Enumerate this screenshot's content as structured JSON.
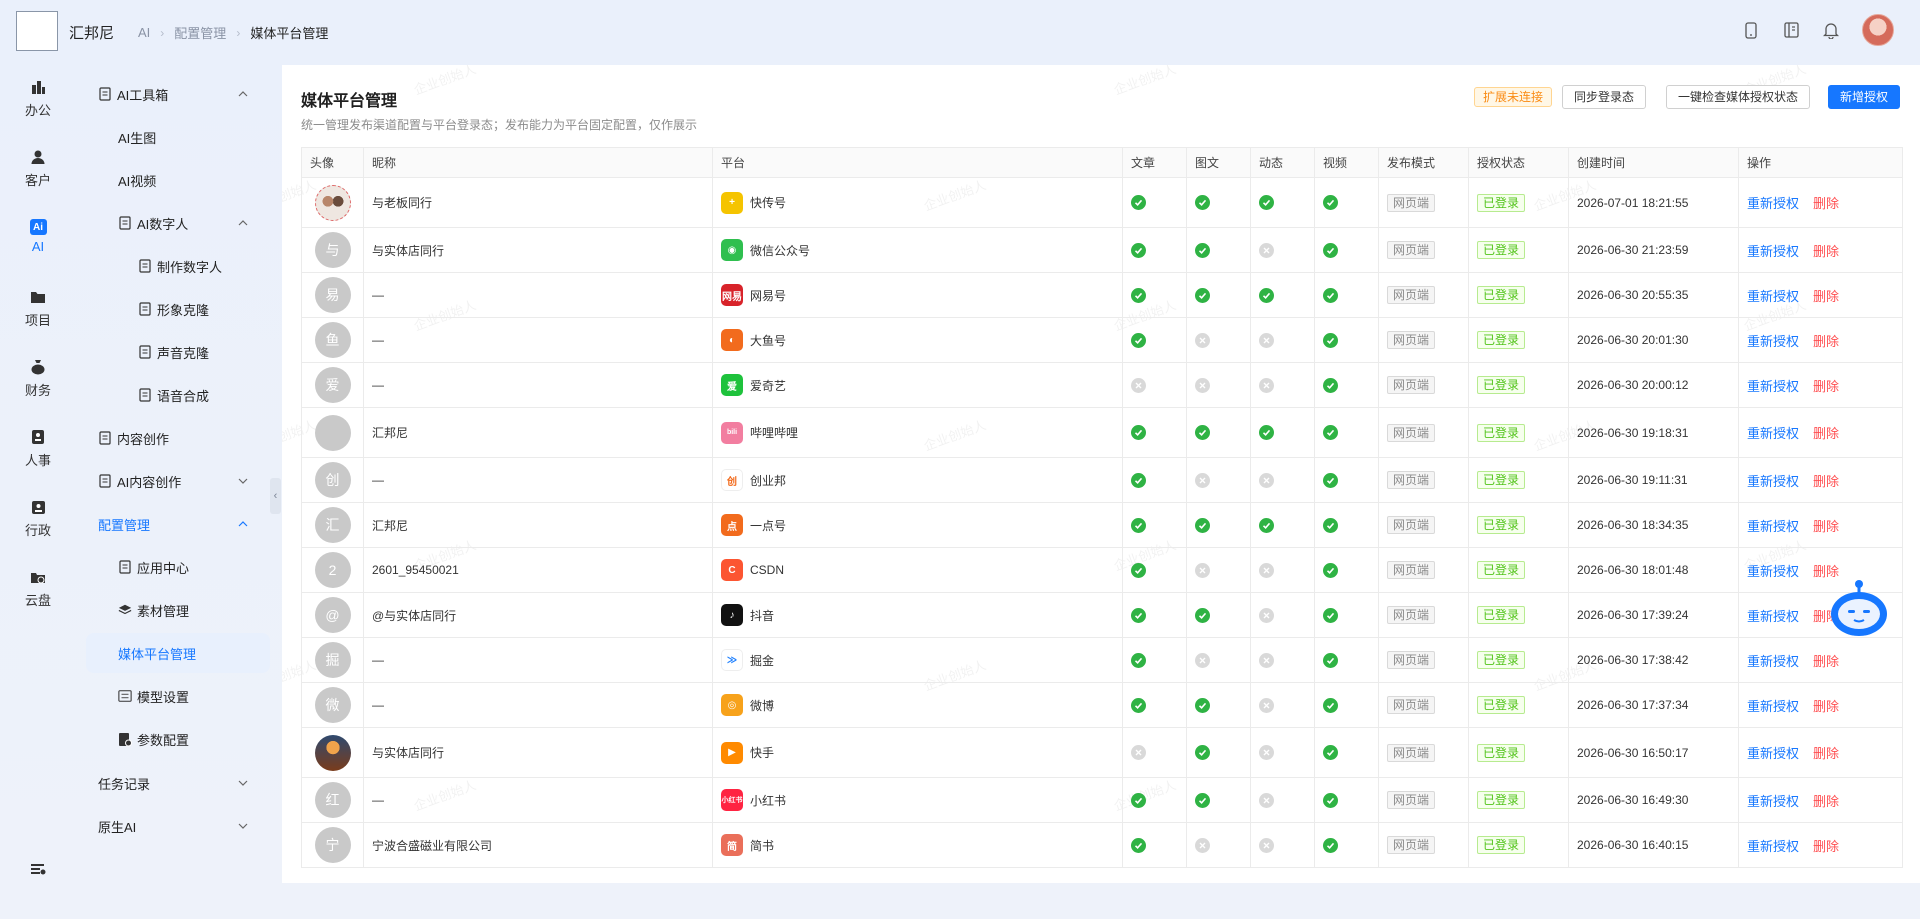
{
  "header": {
    "brand": "汇邦尼",
    "breadcrumbs": [
      "AI",
      "配置管理",
      "媒体平台管理"
    ]
  },
  "rail": [
    {
      "label": "办公",
      "icon": "office-icon"
    },
    {
      "label": "客户",
      "icon": "customer-icon"
    },
    {
      "label": "AI",
      "icon": "ai-icon",
      "active": true
    },
    {
      "label": "项目",
      "icon": "project-icon"
    },
    {
      "label": "财务",
      "icon": "finance-icon"
    },
    {
      "label": "人事",
      "icon": "hr-icon"
    },
    {
      "label": "行政",
      "icon": "admin-icon"
    },
    {
      "label": "云盘",
      "icon": "cloud-disk-icon"
    }
  ],
  "sidebar": {
    "ai_toolbox": "AI工具箱",
    "ai_image": "AI生图",
    "ai_video": "AI视频",
    "ai_digital_human": "AI数字人",
    "make_digital_human": "制作数字人",
    "image_clone": "形象克隆",
    "voice_clone": "声音克隆",
    "speech_synthesis": "语音合成",
    "content_creation": "内容创作",
    "ai_content_creation": "AI内容创作",
    "config_management": "配置管理",
    "app_center": "应用中心",
    "material_management": "素材管理",
    "media_platform": "媒体平台管理",
    "model_settings": "模型设置",
    "param_config": "参数配置",
    "task_records": "任务记录",
    "native_ai": "原生AI"
  },
  "main": {
    "title": "媒体平台管理",
    "subtitle": "统一管理发布渠道配置与平台登录态；发布能力为平台固定配置，仅作展示",
    "tag_extension": "扩展未连接",
    "btn_sync": "同步登录态",
    "btn_check": "一键检查媒体授权状态",
    "btn_add": "新增授权",
    "watermark": "企业创始人",
    "columns": [
      "头像",
      "昵称",
      "平台",
      "文章",
      "图文",
      "动态",
      "视频",
      "发布模式",
      "授权状态",
      "创建时间",
      "操作"
    ],
    "op_reauth": "重新授权",
    "op_delete": "删除",
    "rows": [
      {
        "avatar": "",
        "avatar_style": "img1",
        "nickname": "与老板同行",
        "platform": "快传号",
        "pcolor": "#f5c400",
        "pglyph": "+",
        "caps": [
          1,
          1,
          1,
          1
        ],
        "mode": "网页端",
        "auth": "已登录",
        "time": "2026-07-01 18:21:55"
      },
      {
        "avatar": "与",
        "nickname": "与实体店同行",
        "platform": "微信公众号",
        "pcolor": "#2fbf4f",
        "pglyph": "◉",
        "caps": [
          1,
          1,
          0,
          1
        ],
        "mode": "网页端",
        "auth": "已登录",
        "time": "2026-06-30 21:23:59"
      },
      {
        "avatar": "易",
        "nickname": "—",
        "platform": "网易号",
        "pcolor": "#d8232a",
        "pglyph": "网易",
        "caps": [
          1,
          1,
          1,
          1
        ],
        "mode": "网页端",
        "auth": "已登录",
        "time": "2026-06-30 20:55:35"
      },
      {
        "avatar": "鱼",
        "nickname": "—",
        "platform": "大鱼号",
        "pcolor": "#f26b1d",
        "pglyph": "◐",
        "caps": [
          1,
          0,
          0,
          1
        ],
        "mode": "网页端",
        "auth": "已登录",
        "time": "2026-06-30 20:01:30"
      },
      {
        "avatar": "爱",
        "nickname": "—",
        "platform": "爱奇艺",
        "pcolor": "#1ec23c",
        "pglyph": "爱",
        "caps": [
          0,
          0,
          0,
          1
        ],
        "mode": "网页端",
        "auth": "已登录",
        "time": "2026-06-30 20:00:12"
      },
      {
        "avatar": "",
        "nickname": "汇邦尼",
        "platform": "哔哩哔哩",
        "pcolor": "#f27ea0",
        "pglyph": "bili",
        "caps": [
          1,
          1,
          1,
          1
        ],
        "mode": "网页端",
        "auth": "已登录",
        "time": "2026-06-30 19:18:31"
      },
      {
        "avatar": "创",
        "nickname": "—",
        "platform": "创业邦",
        "pcolor": "#ffffff",
        "pglyph": "创",
        "pfg": "#f26b1d",
        "caps": [
          1,
          0,
          0,
          1
        ],
        "mode": "网页端",
        "auth": "已登录",
        "time": "2026-06-30 19:11:31"
      },
      {
        "avatar": "汇",
        "nickname": "汇邦尼",
        "platform": "一点号",
        "pcolor": "#f26b1d",
        "pglyph": "点",
        "caps": [
          1,
          1,
          1,
          1
        ],
        "mode": "网页端",
        "auth": "已登录",
        "time": "2026-06-30 18:34:35"
      },
      {
        "avatar": "2",
        "nickname": "2601_95450021",
        "platform": "CSDN",
        "pcolor": "#fc5531",
        "pglyph": "C",
        "caps": [
          1,
          0,
          0,
          1
        ],
        "mode": "网页端",
        "auth": "已登录",
        "time": "2026-06-30 18:01:48"
      },
      {
        "avatar": "@",
        "nickname": "@与实体店同行",
        "platform": "抖音",
        "pcolor": "#111111",
        "pglyph": "♪",
        "caps": [
          1,
          1,
          0,
          1
        ],
        "mode": "网页端",
        "auth": "已登录",
        "time": "2026-06-30 17:39:24"
      },
      {
        "avatar": "掘",
        "nickname": "—",
        "platform": "掘金",
        "pcolor": "#ffffff",
        "pglyph": "≫",
        "pfg": "#1e80ff",
        "caps": [
          1,
          0,
          0,
          1
        ],
        "mode": "网页端",
        "auth": "已登录",
        "time": "2026-06-30 17:38:42"
      },
      {
        "avatar": "微",
        "nickname": "—",
        "platform": "微博",
        "pcolor": "#f7a21b",
        "pglyph": "◎",
        "caps": [
          1,
          1,
          0,
          1
        ],
        "mode": "网页端",
        "auth": "已登录",
        "time": "2026-06-30 17:37:34"
      },
      {
        "avatar": "",
        "avatar_style": "img2",
        "nickname": "与实体店同行",
        "platform": "快手",
        "pcolor": "#ff8a00",
        "pglyph": "▶",
        "caps": [
          0,
          1,
          0,
          1
        ],
        "mode": "网页端",
        "auth": "已登录",
        "time": "2026-06-30 16:50:17"
      },
      {
        "avatar": "红",
        "nickname": "—",
        "platform": "小红书",
        "pcolor": "#ff2442",
        "pglyph": "小红书",
        "caps": [
          1,
          1,
          0,
          1
        ],
        "mode": "网页端",
        "auth": "已登录",
        "time": "2026-06-30 16:49:30"
      },
      {
        "avatar": "宁",
        "nickname": "宁波合盛磁业有限公司",
        "platform": "简书",
        "pcolor": "#ea6f5a",
        "pglyph": "简",
        "caps": [
          1,
          0,
          0,
          1
        ],
        "mode": "网页端",
        "auth": "已登录",
        "time": "2026-06-30 16:40:15"
      }
    ]
  }
}
